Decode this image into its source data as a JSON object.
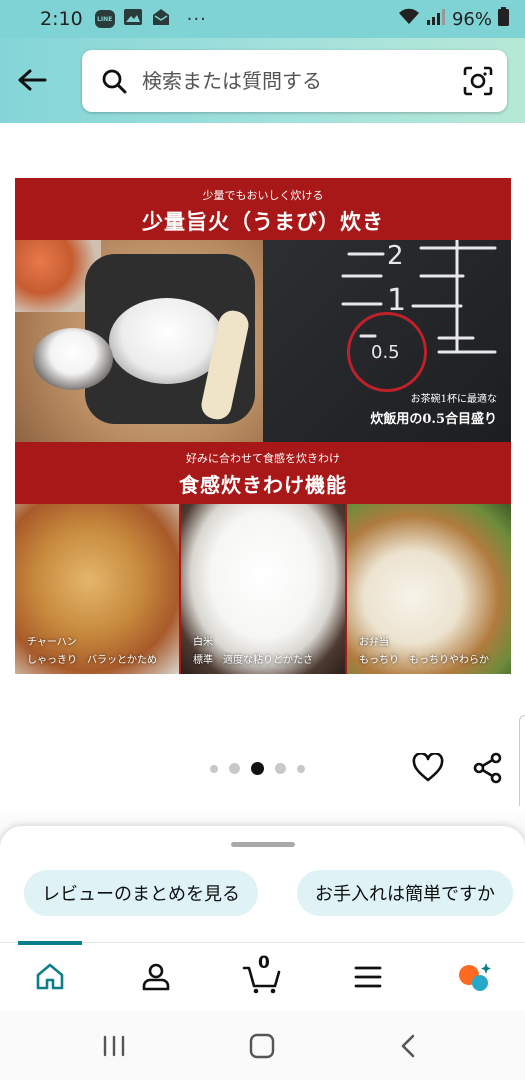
{
  "status_bar": {
    "time": "2:10",
    "line_label": "LINE",
    "overflow": "···",
    "battery": "96%"
  },
  "search": {
    "placeholder": "検索または質問する"
  },
  "product_image": {
    "banner1_sub": "少量でもおいしく炊ける",
    "banner1_main": "少量旨火（うまび）炊き",
    "marks": [
      "2",
      "1",
      "0.5"
    ],
    "mark_caption_1": "お茶碗1杯に最適な",
    "mark_caption_2": "炊飯用の0.5合目盛り",
    "banner2_sub": "好みに合わせて食感を炊きわけ",
    "banner2_main": "食感炊きわけ機能",
    "foods": [
      {
        "title": "チャーハン",
        "desc": "しゃっきり　バラッとかため"
      },
      {
        "title": "白米",
        "desc": "標準　適度な粘りとかたさ"
      },
      {
        "title": "お弁当",
        "desc": "もっちり　もっちりやわらか"
      }
    ]
  },
  "carousel": {
    "total": 5,
    "active_index": 2
  },
  "bottom_sheet": {
    "chips": [
      "レビューのまとめを見る",
      "お手入れは簡単ですか"
    ]
  },
  "bottom_nav": {
    "active": "home",
    "items": [
      "home-icon",
      "account-icon",
      "cart-icon",
      "menu-icon",
      "rufus-icon"
    ],
    "cart_count": "0"
  },
  "colors": {
    "accent": "#0a7f8c",
    "header_start": "#84d5d7",
    "header_end": "#b7e8d6",
    "banner_red": "#a81818",
    "chip_bg": "#dff2f6"
  }
}
